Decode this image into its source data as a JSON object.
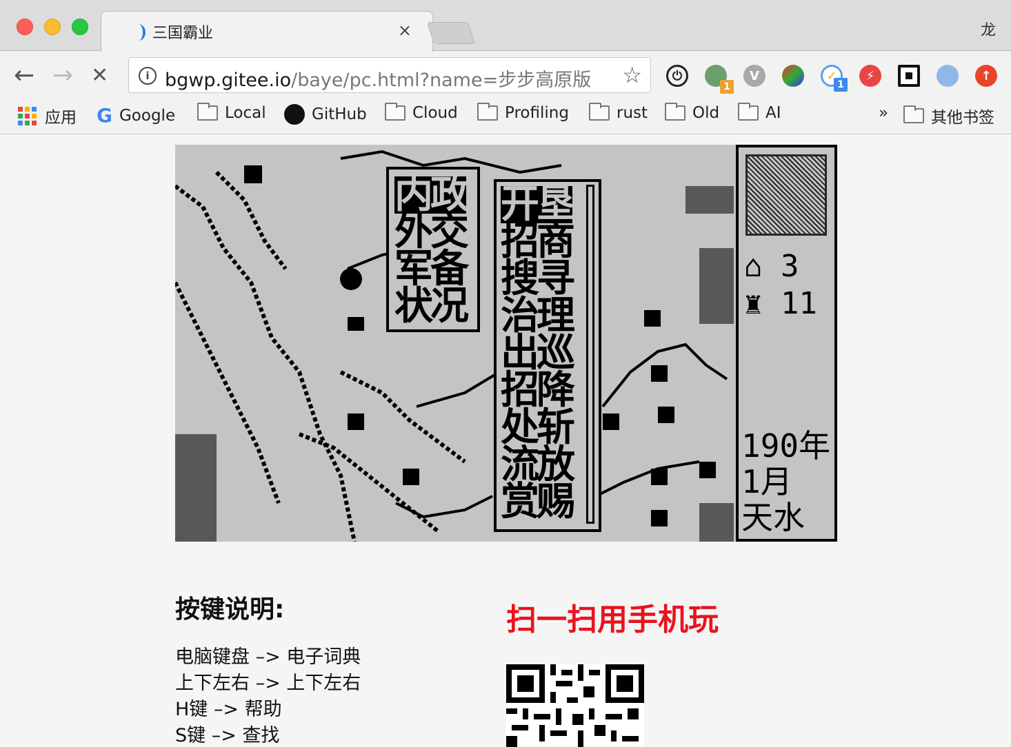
{
  "window": {
    "profile_name": "龙"
  },
  "tab": {
    "title": "三国霸业",
    "close_glyph": "×"
  },
  "toolbar": {
    "back_glyph": "←",
    "forward_glyph": "→",
    "stop_glyph": "✕",
    "info_glyph": "i",
    "star_glyph": "☆",
    "url_host": "bgwp.gitee.io",
    "url_path": "/baye/pc.html?name=步步高原版",
    "ext_badges": [
      "1",
      "1"
    ]
  },
  "bookmarks": {
    "apps": "应用",
    "google": "Google",
    "local": "Local",
    "github": "GitHub",
    "cloud": "Cloud",
    "profiling": "Profiling",
    "rust": "rust",
    "old": "Old",
    "ai": "AI",
    "overflow": "»",
    "other": "其他书签"
  },
  "game": {
    "menu1": [
      "内政",
      "外交",
      "军备",
      "状况"
    ],
    "menu2": [
      "开垦",
      "招商",
      "搜寻",
      "治理",
      "出巡",
      "招降",
      "处斩",
      "流放",
      "赏赐"
    ],
    "stat1": "3",
    "stat2": "11",
    "year": "190年",
    "month": "1月",
    "city": "天水"
  },
  "keys": {
    "title": "按键说明:",
    "lines": [
      "电脑键盘 –> 电子词典",
      "上下左右 –> 上下左右",
      "H键 –> 帮助",
      "S键 –> 查找"
    ]
  },
  "scan": {
    "title": "扫一扫用手机玩"
  },
  "colors": {
    "red_text": "#e8141e",
    "lcd_bg": "#c4c4c4"
  }
}
